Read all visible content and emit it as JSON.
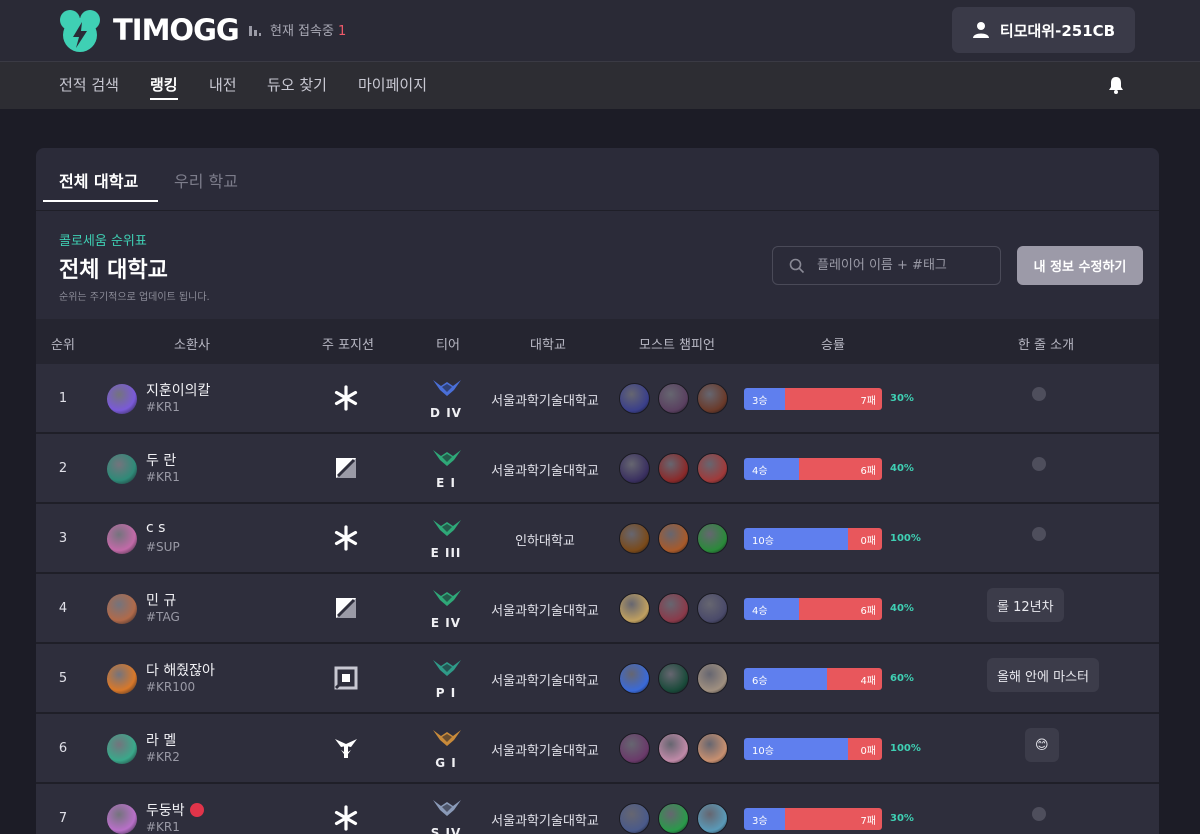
{
  "header": {
    "logo_text": "TIMOGG",
    "online_label": "현재 접속중",
    "online_count": "1",
    "user_name": "티모대위-251CB"
  },
  "nav": {
    "items": [
      "전적 검색",
      "랭킹",
      "내전",
      "듀오 찾기",
      "마이페이지"
    ],
    "active": "랭킹"
  },
  "tabs": [
    "전체 대학교",
    "우리 학교"
  ],
  "ranking": {
    "subtitle": "콜로세움 순위표",
    "title": "전체 대학교",
    "note": "순위는 주기적으로 업데이트 됩니다.",
    "search_placeholder": "플레이어 이름 + #태그",
    "edit_button": "내 정보 수정하기"
  },
  "columns": [
    "순위",
    "소환사",
    "주 포지션",
    "티어",
    "대학교",
    "모스트 챔피언",
    "승률",
    "한 줄 소개"
  ],
  "rows": [
    {
      "rank": "1",
      "name": "지훈이의칼",
      "tag": "#KR1",
      "position": "support",
      "tier": "D IV",
      "tier_color": "#4a6fd8",
      "university": "서울과학기술대학교",
      "wins": "3승",
      "losses": "7패",
      "win_fraction": 0.3,
      "winrate": "30%",
      "intro": "",
      "avatar_color": "#7a5ad8",
      "champ_colors": [
        "#3a3f8a",
        "#5a4060",
        "#6a3a2a"
      ]
    },
    {
      "rank": "2",
      "name": "두 란",
      "tag": "#KR1",
      "position": "jungle",
      "tier": "E I",
      "tier_color": "#2fa878",
      "university": "서울과학기술대학교",
      "wins": "4승",
      "losses": "6패",
      "win_fraction": 0.4,
      "winrate": "40%",
      "intro": "",
      "avatar_color": "#2f8a78",
      "champ_colors": [
        "#3a3060",
        "#8a2a2a",
        "#a03a3a"
      ]
    },
    {
      "rank": "3",
      "name": "c s",
      "tag": "#SUP",
      "position": "support",
      "tier": "E III",
      "tier_color": "#2fa878",
      "university": "인하대학교",
      "wins": "10승",
      "losses": "0패",
      "win_fraction": 0.75,
      "winrate": "100%",
      "intro": "",
      "avatar_color": "#c26aa8",
      "champ_colors": [
        "#7a4a1a",
        "#a85a2a",
        "#2a8a3a"
      ]
    },
    {
      "rank": "4",
      "name": "민 규",
      "tag": "#TAG",
      "position": "jungle",
      "tier": "E IV",
      "tier_color": "#2fa878",
      "university": "서울과학기술대학교",
      "wins": "4승",
      "losses": "6패",
      "win_fraction": 0.4,
      "winrate": "40%",
      "intro": "롤 12년차",
      "avatar_color": "#b06a4a",
      "champ_colors": [
        "#c0a060",
        "#8a3a4a",
        "#4a4a6a"
      ]
    },
    {
      "rank": "5",
      "name": "다 해줬잖아",
      "tag": "#KR100",
      "position": "mid",
      "tier": "P I",
      "tier_color": "#2f9a88",
      "university": "서울과학기술대학교",
      "wins": "6승",
      "losses": "4패",
      "win_fraction": 0.6,
      "winrate": "60%",
      "intro": "올해 안에 마스터",
      "avatar_color": "#d8782a",
      "champ_colors": [
        "#3a6ad8",
        "#1a4a3a",
        "#a09080"
      ]
    },
    {
      "rank": "6",
      "name": "라 멜",
      "tag": "#KR2",
      "position": "top",
      "tier": "G I",
      "tier_color": "#c88a3a",
      "university": "서울과학기술대학교",
      "wins": "10승",
      "losses": "0패",
      "win_fraction": 0.75,
      "winrate": "100%",
      "intro": "😊",
      "avatar_color": "#3aa88a",
      "champ_colors": [
        "#6a3a6a",
        "#c08aa8",
        "#c89070"
      ]
    },
    {
      "rank": "7",
      "name": "두둥박",
      "tag": "#KR1",
      "position": "support",
      "tier": "S IV",
      "tier_color": "#8a9ab8",
      "university": "서울과학기술대학교",
      "wins": "3승",
      "losses": "7패",
      "win_fraction": 0.3,
      "winrate": "30%",
      "intro": "",
      "avatar_color": "#b870c8",
      "champ_colors": [
        "#4a5a8a",
        "#2a9a4a",
        "#5a9ab8"
      ],
      "badge": true
    }
  ]
}
